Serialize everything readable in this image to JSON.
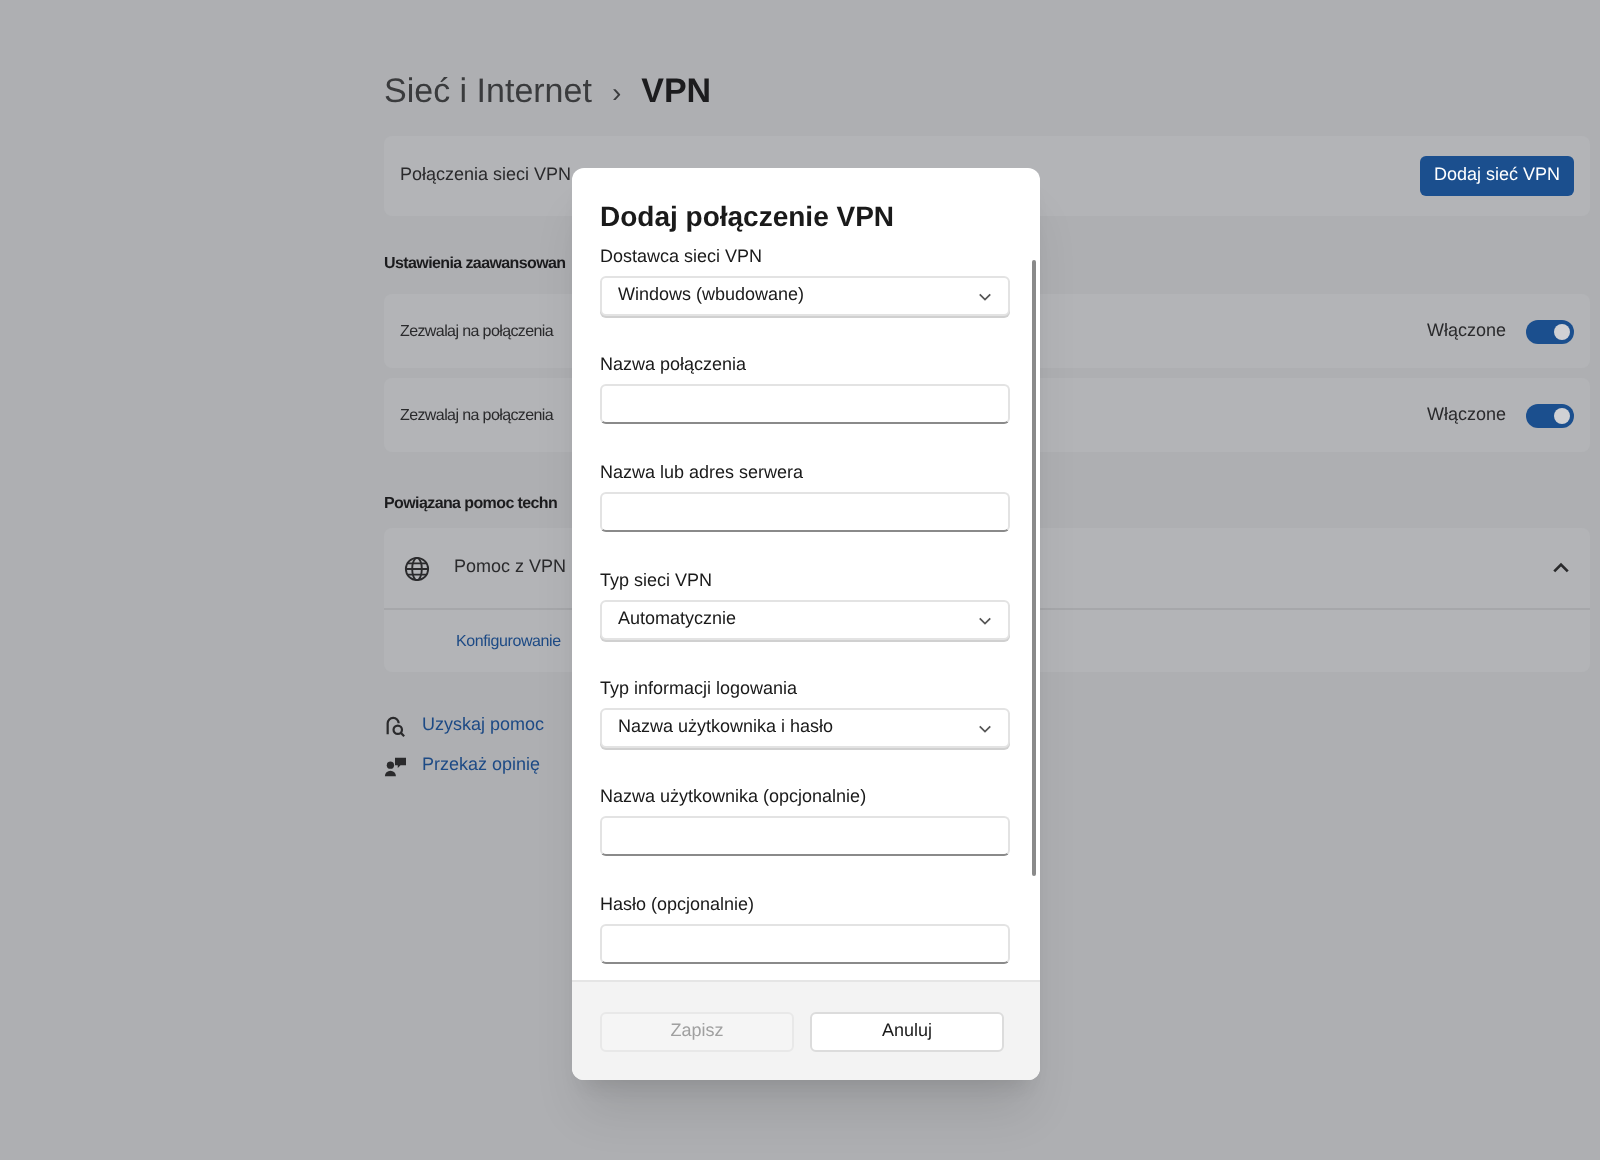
{
  "header": {
    "parent": "Sieć i Internet",
    "separator": "›",
    "current": "VPN"
  },
  "vpn_connections": {
    "label": "Połączenia sieci VPN",
    "button": "Dodaj sieć VPN"
  },
  "advanced": {
    "heading": "Ustawienia zaawansowan",
    "settings": [
      {
        "label": "Zezwalaj na połączenia",
        "state_text": "Włączone",
        "on": true
      },
      {
        "label": "Zezwalaj na połączenia",
        "state_text": "Włączone",
        "on": true
      }
    ]
  },
  "related_help": {
    "heading": "Powiązana pomoc techn",
    "item": {
      "label": "Pomoc z VPN",
      "expanded": true,
      "links": [
        "Konfigurowanie"
      ]
    }
  },
  "footer_links": [
    {
      "kind": "help",
      "label": "Uzyskaj pomoc"
    },
    {
      "kind": "feedback",
      "label": "Przekaż opinię"
    }
  ],
  "dialog": {
    "title": "Dodaj połączenie VPN",
    "fields": [
      {
        "kind": "dropdown",
        "label": "Dostawca sieci VPN",
        "value": "Windows (wbudowane)"
      },
      {
        "kind": "text",
        "label": "Nazwa połączenia"
      },
      {
        "kind": "text",
        "label": "Nazwa lub adres serwera"
      },
      {
        "kind": "dropdown",
        "label": "Typ sieci VPN",
        "value": "Automatycznie"
      },
      {
        "kind": "dropdown",
        "label": "Typ informacji logowania",
        "value": "Nazwa użytkownika i hasło"
      },
      {
        "kind": "text",
        "label": "Nazwa użytkownika (opcjonalnie)"
      },
      {
        "kind": "text",
        "label": "Hasło (opcjonalnie)"
      }
    ],
    "buttons": [
      {
        "label": "Zapisz",
        "disabled": true
      },
      {
        "label": "Anuluj",
        "disabled": false
      }
    ]
  }
}
